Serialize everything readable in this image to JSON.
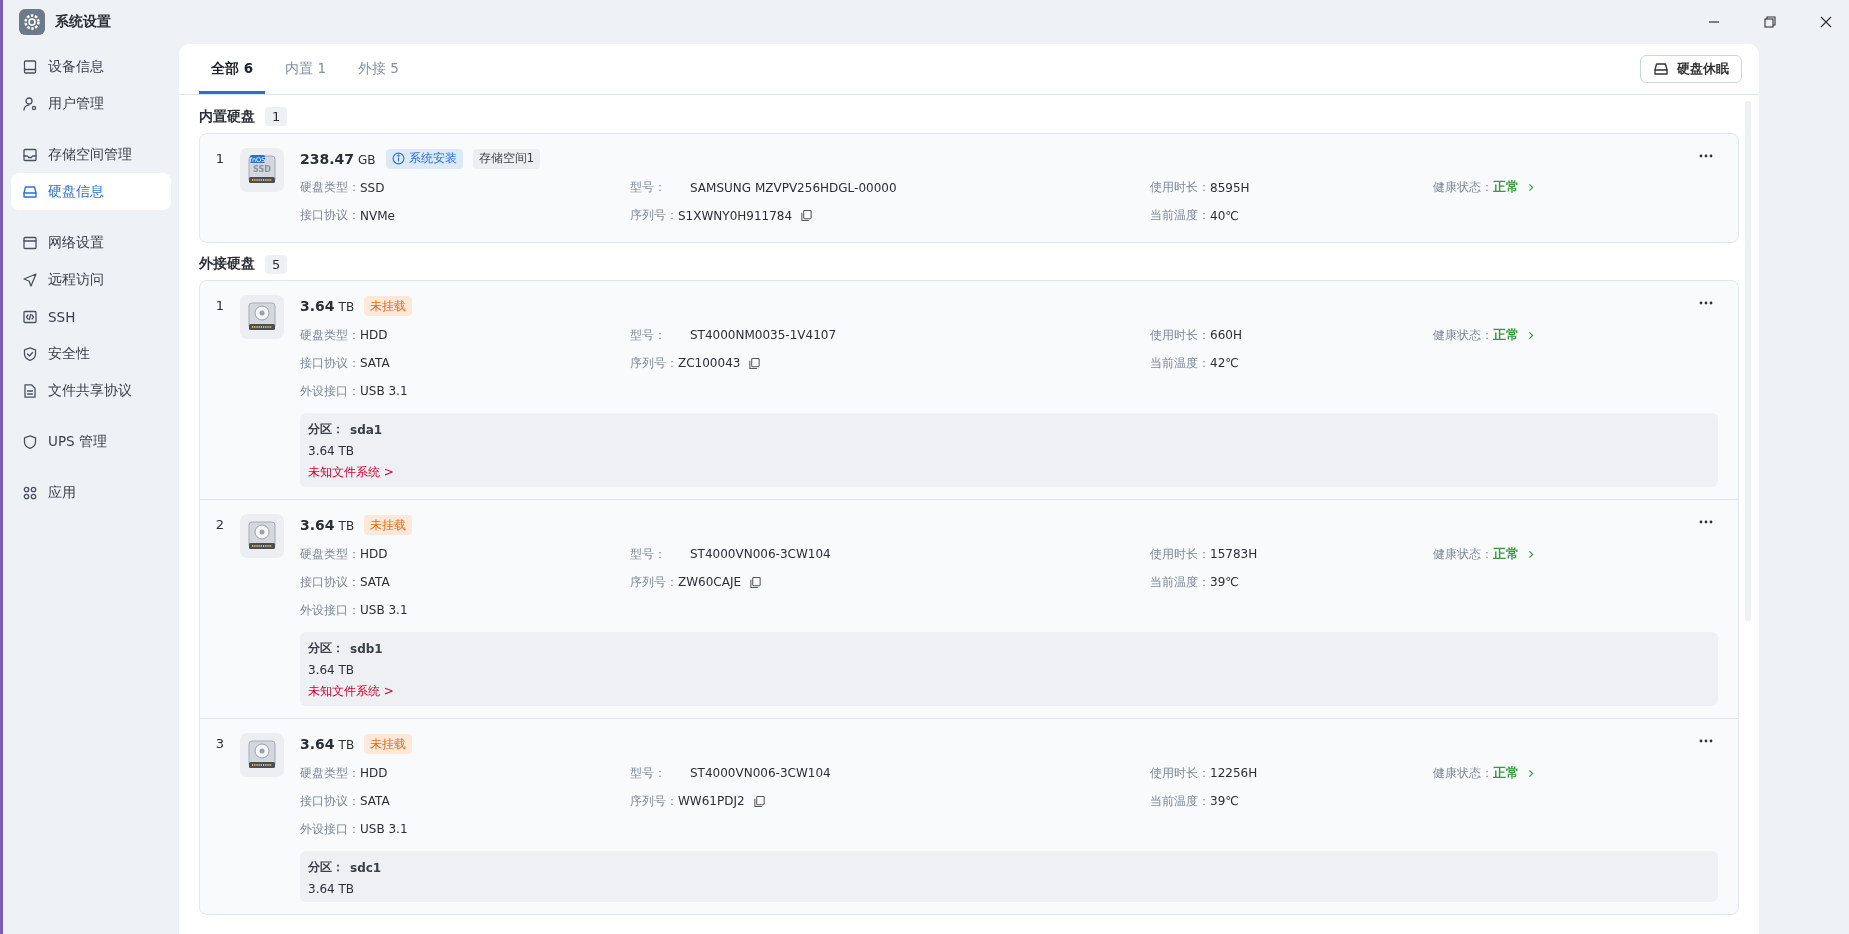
{
  "window": {
    "title": "系统设置"
  },
  "sidebar": {
    "groups": [
      [
        {
          "label": "设备信息",
          "selected": false
        },
        {
          "label": "用户管理",
          "selected": false
        }
      ],
      [
        {
          "label": "存储空间管理",
          "selected": false
        },
        {
          "label": "硬盘信息",
          "selected": true
        }
      ],
      [
        {
          "label": "网络设置",
          "selected": false
        },
        {
          "label": "远程访问",
          "selected": false
        },
        {
          "label": "SSH",
          "selected": false
        },
        {
          "label": "安全性",
          "selected": false
        },
        {
          "label": "文件共享协议",
          "selected": false
        }
      ],
      [
        {
          "label": "UPS 管理",
          "selected": false
        }
      ],
      [
        {
          "label": "应用",
          "selected": false
        }
      ]
    ]
  },
  "tabs": [
    {
      "label": "全部 6",
      "selected": true
    },
    {
      "label": "内置 1",
      "selected": false
    },
    {
      "label": "外接 5",
      "selected": false
    }
  ],
  "sleep_button": {
    "label": "硬盘休眠"
  },
  "sections": [
    {
      "title": "内置硬盘",
      "count": "1",
      "disks": [
        {
          "index": "1",
          "kind": "ssd",
          "icon_badge": "fnOS",
          "icon_text": "SSD",
          "size": "238.47",
          "unit": "GB",
          "tags": [
            {
              "label": "系统安装",
              "kind": "info"
            },
            {
              "label": "存储空间1",
              "kind": "plain"
            }
          ],
          "rows": [
            [
              {
                "label": "硬盘类型：",
                "value": "SSD"
              },
              {
                "label": "型号：",
                "value": "SAMSUNG MZVPV256HDGL-00000"
              },
              {
                "label": "使用时长：",
                "value": "8595H"
              },
              {
                "label": "健康状态：",
                "value": "正常",
                "kind": "health"
              }
            ],
            [
              {
                "label": "接口协议：",
                "value": "NVMe"
              },
              {
                "label": "序列号：",
                "value": "S1XWNY0H911784",
                "kind": "copy"
              },
              {
                "label": "当前温度：",
                "value": "40℃"
              }
            ]
          ]
        }
      ]
    },
    {
      "title": "外接硬盘",
      "count": "5",
      "disks": [
        {
          "index": "1",
          "kind": "hdd",
          "size": "3.64",
          "unit": "TB",
          "tags": [
            {
              "label": "未挂载",
              "kind": "warning"
            }
          ],
          "rows": [
            [
              {
                "label": "硬盘类型：",
                "value": "HDD"
              },
              {
                "label": "型号：",
                "value": "ST4000NM0035-1V4107"
              },
              {
                "label": "使用时长：",
                "value": "660H"
              },
              {
                "label": "健康状态：",
                "value": "正常",
                "kind": "health"
              }
            ],
            [
              {
                "label": "接口协议：",
                "value": "SATA"
              },
              {
                "label": "序列号：",
                "value": "ZC100043",
                "kind": "copy"
              },
              {
                "label": "当前温度：",
                "value": "42℃"
              }
            ],
            [
              {
                "label": "外设接口：",
                "value": "USB 3.1"
              }
            ]
          ],
          "partitions": [
            {
              "label": "分区：",
              "name": "sda1",
              "size": "3.64 TB",
              "link": "未知文件系统 >"
            }
          ]
        },
        {
          "index": "2",
          "kind": "hdd",
          "size": "3.64",
          "unit": "TB",
          "tags": [
            {
              "label": "未挂载",
              "kind": "warning"
            }
          ],
          "rows": [
            [
              {
                "label": "硬盘类型：",
                "value": "HDD"
              },
              {
                "label": "型号：",
                "value": "ST4000VN006-3CW104"
              },
              {
                "label": "使用时长：",
                "value": "15783H"
              },
              {
                "label": "健康状态：",
                "value": "正常",
                "kind": "health"
              }
            ],
            [
              {
                "label": "接口协议：",
                "value": "SATA"
              },
              {
                "label": "序列号：",
                "value": "ZW60CAJE",
                "kind": "copy"
              },
              {
                "label": "当前温度：",
                "value": "39℃"
              }
            ],
            [
              {
                "label": "外设接口：",
                "value": "USB 3.1"
              }
            ]
          ],
          "partitions": [
            {
              "label": "分区：",
              "name": "sdb1",
              "size": "3.64 TB",
              "link": "未知文件系统 >"
            }
          ]
        },
        {
          "index": "3",
          "kind": "hdd",
          "size": "3.64",
          "unit": "TB",
          "tags": [
            {
              "label": "未挂载",
              "kind": "warning"
            }
          ],
          "rows": [
            [
              {
                "label": "硬盘类型：",
                "value": "HDD"
              },
              {
                "label": "型号：",
                "value": "ST4000VN006-3CW104"
              },
              {
                "label": "使用时长：",
                "value": "12256H"
              },
              {
                "label": "健康状态：",
                "value": "正常",
                "kind": "health"
              }
            ],
            [
              {
                "label": "接口协议：",
                "value": "SATA"
              },
              {
                "label": "序列号：",
                "value": "WW61PDJ2",
                "kind": "copy"
              },
              {
                "label": "当前温度：",
                "value": "39℃"
              }
            ],
            [
              {
                "label": "外设接口：",
                "value": "USB 3.1"
              }
            ]
          ],
          "partitions": [
            {
              "label": "分区：",
              "name": "sdc1",
              "size": "3.64 TB"
            }
          ]
        }
      ]
    }
  ]
}
